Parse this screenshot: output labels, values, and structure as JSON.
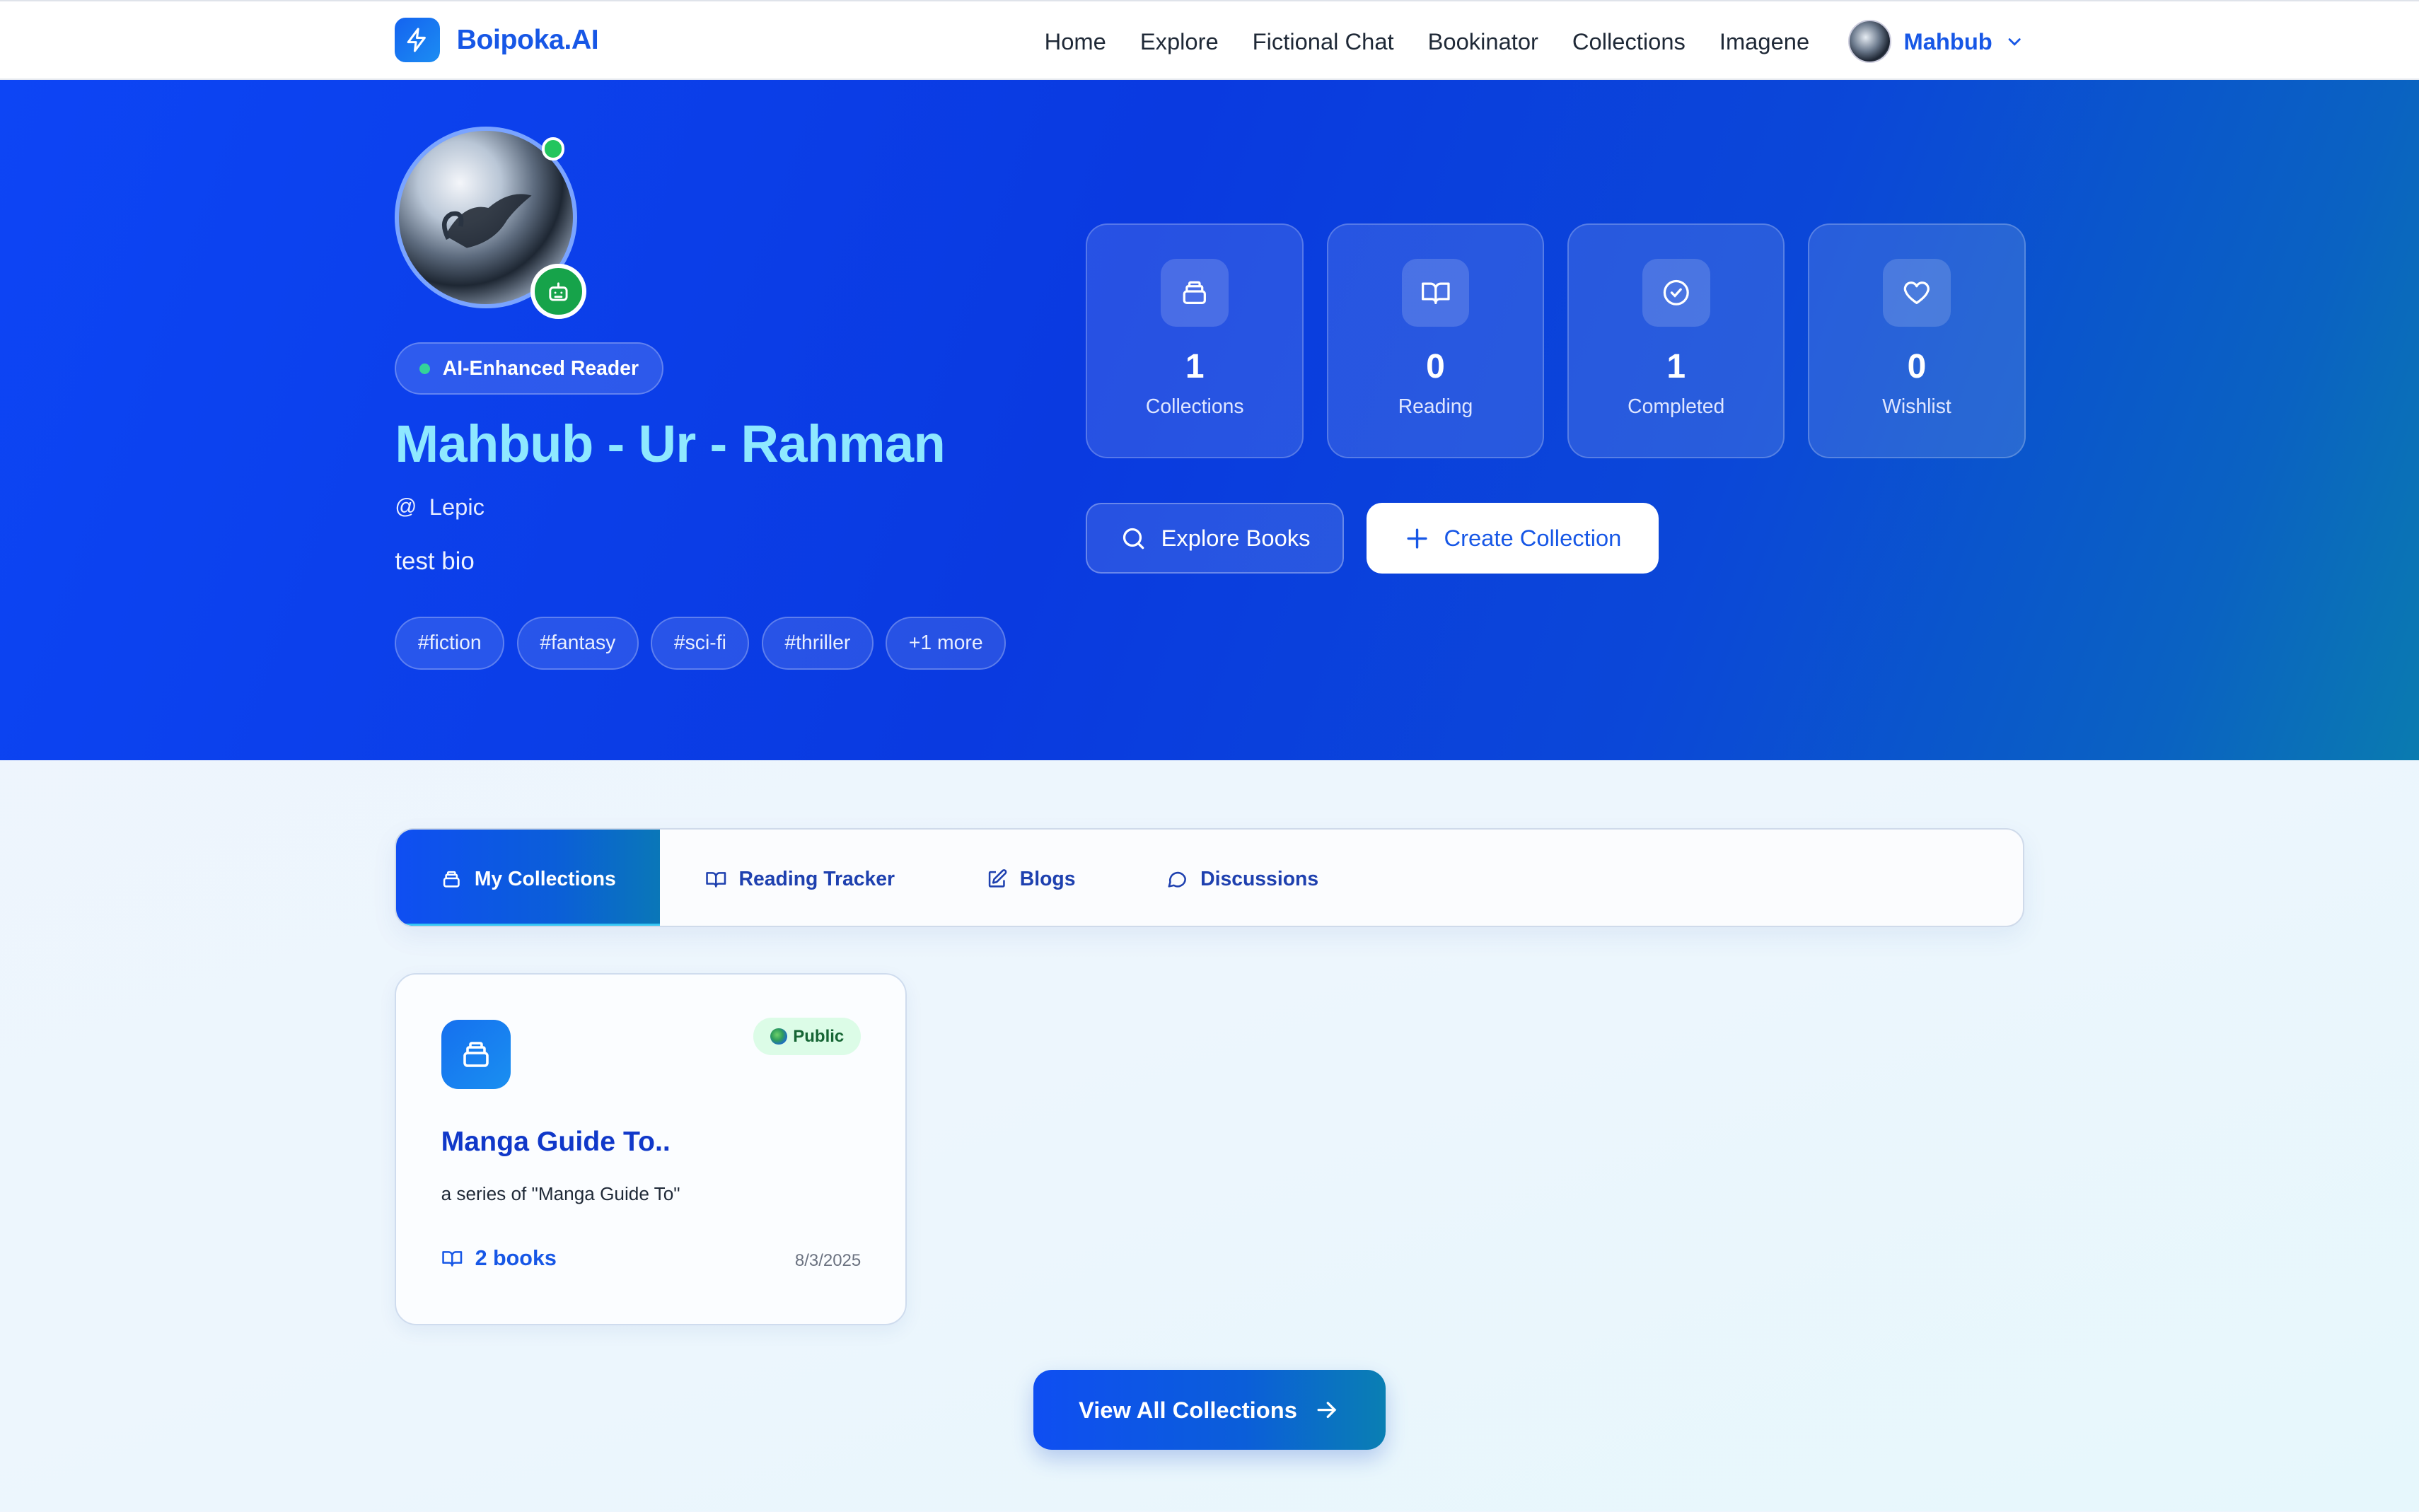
{
  "brand": {
    "name": "Boipoka.AI"
  },
  "nav": {
    "links": [
      "Home",
      "Explore",
      "Fictional Chat",
      "Bookinator",
      "Collections",
      "Imagene"
    ],
    "user_name": "Mahbub"
  },
  "profile": {
    "badge": "AI-Enhanced Reader",
    "name": "Mahbub - Ur - Rahman",
    "username": "Lepic",
    "bio": "test bio",
    "tags": [
      "#fiction",
      "#fantasy",
      "#sci-fi",
      "#thriller",
      "+1 more"
    ],
    "online": true
  },
  "stats": [
    {
      "value": "1",
      "label": "Collections",
      "icon": "collection-icon"
    },
    {
      "value": "0",
      "label": "Reading",
      "icon": "book-open-icon"
    },
    {
      "value": "1",
      "label": "Completed",
      "icon": "check-circle-icon"
    },
    {
      "value": "0",
      "label": "Wishlist",
      "icon": "heart-icon"
    }
  ],
  "actions": {
    "explore": "Explore Books",
    "create": "Create Collection"
  },
  "tabs": [
    {
      "label": "My Collections",
      "icon": "collection-icon",
      "active": true
    },
    {
      "label": "Reading Tracker",
      "icon": "book-open-icon",
      "active": false
    },
    {
      "label": "Blogs",
      "icon": "edit-icon",
      "active": false
    },
    {
      "label": "Discussions",
      "icon": "chat-bubble-icon",
      "active": false
    }
  ],
  "collections": [
    {
      "title": "Manga Guide To..",
      "visibility": "Public",
      "description": "a series of \"Manga Guide To\"",
      "books": "2 books",
      "date": "8/3/2025"
    }
  ],
  "view_all": "View All Collections",
  "colors": {
    "brand": "#1757e6",
    "hero_start": "#0d45f5",
    "hero_end": "#0a7bb0",
    "name_text": "#8ee8ff",
    "online": "#22c55e",
    "public_badge_bg": "#dcfce7"
  }
}
